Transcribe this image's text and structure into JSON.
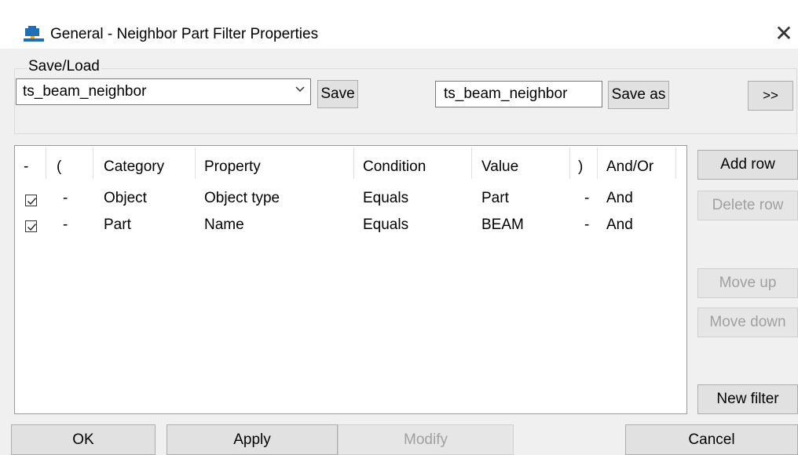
{
  "window": {
    "title": "General - Neighbor Part Filter Properties",
    "close_symbol": "✕"
  },
  "saveload": {
    "label": "Save/Load",
    "selected": "ts_beam_neighbor",
    "save_label": "Save",
    "saveas_value": "ts_beam_neighbor",
    "saveas_label": "Save as",
    "more_label": ">>"
  },
  "table": {
    "headers": [
      "-",
      "(",
      "Category",
      "Property",
      "Condition",
      "Value",
      ")",
      "And/Or"
    ],
    "rows": [
      {
        "checked": true,
        "open": "-",
        "category": "Object",
        "property": "Object type",
        "condition": "Equals",
        "value": "Part",
        "close": "-",
        "andor": "And"
      },
      {
        "checked": true,
        "open": "-",
        "category": "Part",
        "property": "Name",
        "condition": "Equals",
        "value": "BEAM",
        "close": "-",
        "andor": "And"
      }
    ]
  },
  "side": {
    "add_row": "Add row",
    "delete_row": "Delete row",
    "move_up": "Move up",
    "move_down": "Move down",
    "new_filter": "New filter"
  },
  "footer": {
    "ok": "OK",
    "apply": "Apply",
    "modify": "Modify",
    "cancel": "Cancel"
  }
}
